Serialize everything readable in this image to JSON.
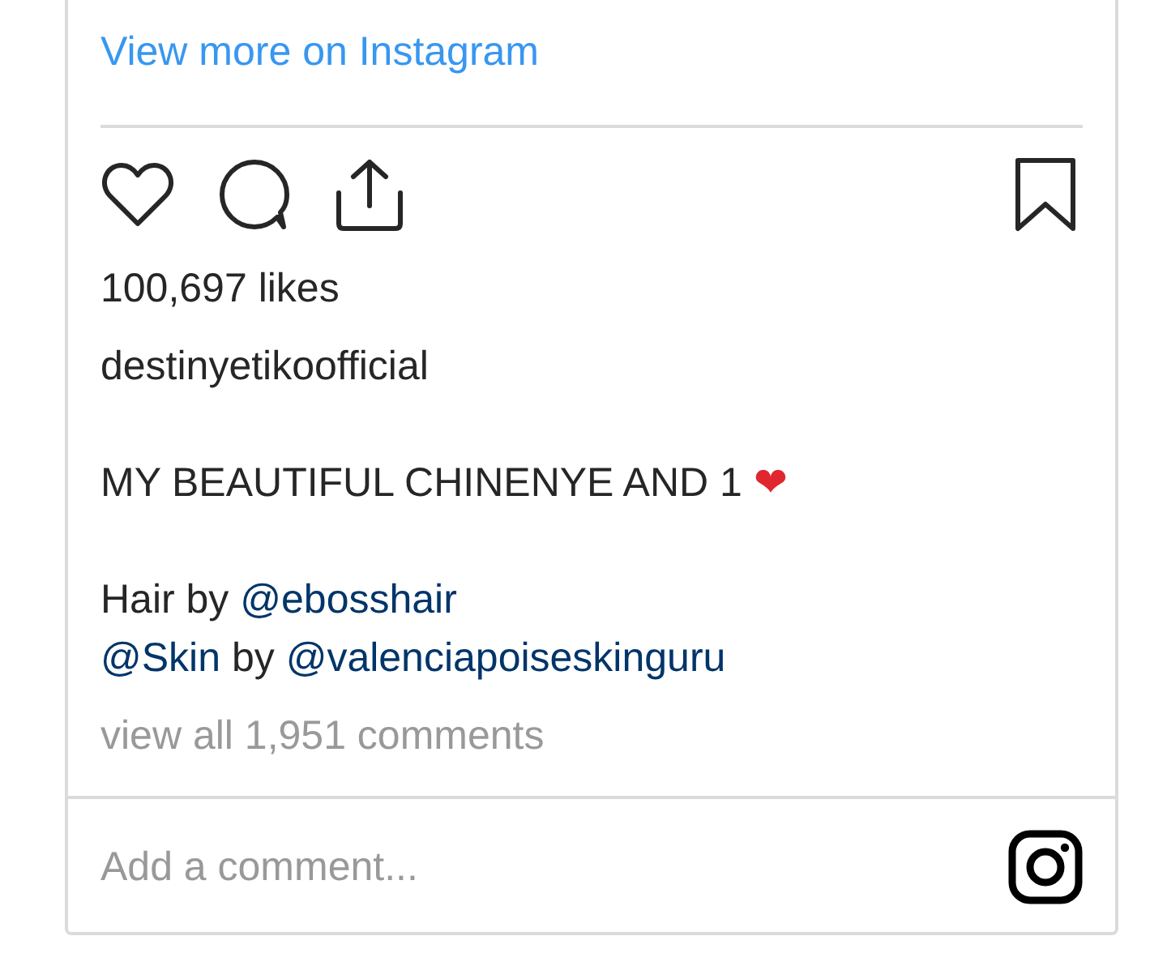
{
  "link": {
    "label": "View more on Instagram"
  },
  "likes": "100,697 likes",
  "username": "destinyetikoofficial",
  "caption": {
    "paragraphs": [
      {
        "lines": [
          [
            {
              "kind": "plain",
              "text": "MY BEAUTIFUL CHINENYE AND 1 "
            },
            {
              "kind": "emoji",
              "text": "❤"
            }
          ]
        ]
      },
      {
        "lines": [
          [
            {
              "kind": "plain",
              "text": "Hair by "
            },
            {
              "kind": "mention",
              "text": "@ebosshair"
            }
          ],
          [
            {
              "kind": "mention",
              "text": "@Skin"
            },
            {
              "kind": "plain",
              "text": " by "
            },
            {
              "kind": "mention",
              "text": "@valenciapoiseskinguru"
            }
          ]
        ]
      }
    ]
  },
  "comments_link": "view all 1,951 comments",
  "comment_field": {
    "placeholder": "Add a comment..."
  }
}
